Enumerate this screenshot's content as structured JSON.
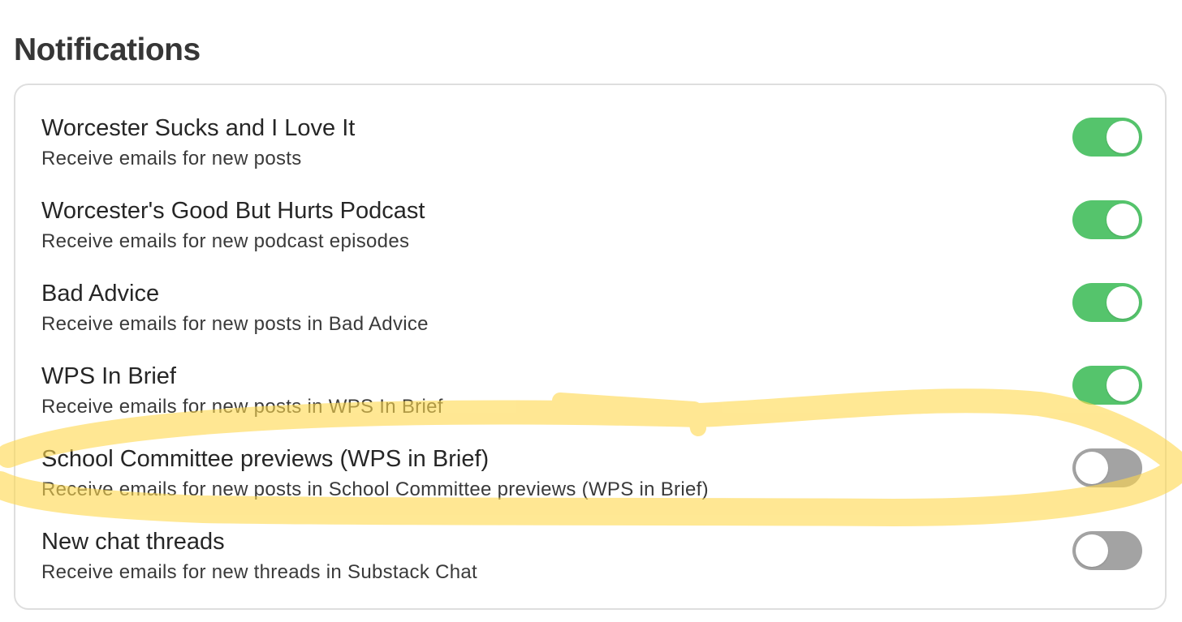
{
  "header": {
    "title": "Notifications"
  },
  "settings": [
    {
      "title": "Worcester Sucks and I Love It",
      "description": "Receive emails for new posts",
      "enabled": true
    },
    {
      "title": "Worcester's Good But Hurts Podcast",
      "description": "Receive emails for new podcast episodes",
      "enabled": true
    },
    {
      "title": "Bad Advice",
      "description": "Receive emails for new posts in Bad Advice",
      "enabled": true
    },
    {
      "title": "WPS In Brief",
      "description": "Receive emails for new posts in WPS In Brief",
      "enabled": true
    },
    {
      "title": "School Committee previews (WPS in Brief)",
      "description": "Receive emails for new posts in School Committee previews (WPS in Brief)",
      "enabled": false
    },
    {
      "title": "New chat threads",
      "description": "Receive emails for new threads in Substack Chat",
      "enabled": false
    }
  ],
  "colors": {
    "toggle_on": "#55c46c",
    "toggle_off": "#a3a3a3",
    "highlighter": "#ffd84d"
  }
}
